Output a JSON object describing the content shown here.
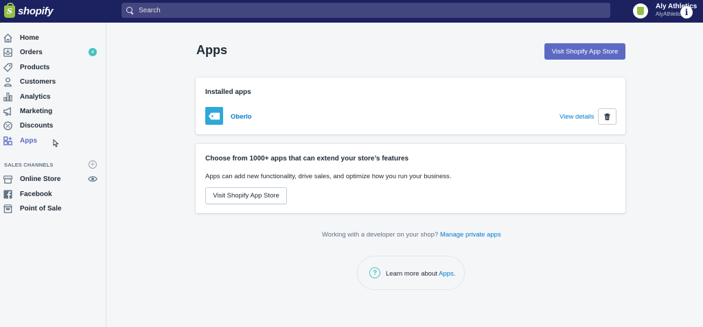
{
  "topbar": {
    "logo_text": "shopify",
    "logo_mark": "S",
    "search_placeholder": "Search",
    "store_name": "Aly Athletics",
    "store_domain": "AlyAthletics",
    "info_glyph": "i"
  },
  "sidebar": {
    "items": [
      {
        "label": "Home",
        "icon": "home-icon"
      },
      {
        "label": "Orders",
        "icon": "orders-icon",
        "badge": "4"
      },
      {
        "label": "Products",
        "icon": "tag-icon"
      },
      {
        "label": "Customers",
        "icon": "person-icon"
      },
      {
        "label": "Analytics",
        "icon": "bar-chart-icon"
      },
      {
        "label": "Marketing",
        "icon": "megaphone-icon"
      },
      {
        "label": "Discounts",
        "icon": "discount-icon"
      },
      {
        "label": "Apps",
        "icon": "apps-icon",
        "active": true
      }
    ],
    "channels_title": "SALES CHANNELS",
    "add_glyph": "+",
    "channels": [
      {
        "label": "Online Store",
        "icon": "store-icon"
      },
      {
        "label": "Facebook",
        "icon": "facebook-icon"
      },
      {
        "label": "Point of Sale",
        "icon": "pos-icon"
      }
    ]
  },
  "main": {
    "title": "Apps",
    "visit_store_label": "Visit Shopify App Store",
    "installed": {
      "heading": "Installed apps",
      "app_name": "Oberlo",
      "view_details": "View details"
    },
    "choose": {
      "heading": "Choose from 1000+ apps that can extend your store’s features",
      "text": "Apps can add new functionality, drive sales, and optimize how you run your business.",
      "button_label": "Visit Shopify App Store"
    },
    "footer": {
      "prefix": "Working with a developer on your shop?",
      "link": "Manage private apps"
    },
    "learn_more": {
      "prefix": "Learn more about",
      "link": "Apps",
      "suffix": ".",
      "help_glyph": "?"
    }
  },
  "colors": {
    "topbar": "#1c2260",
    "primary": "#5c6ac4",
    "link": "#007ace",
    "badge": "#47c1bf"
  }
}
